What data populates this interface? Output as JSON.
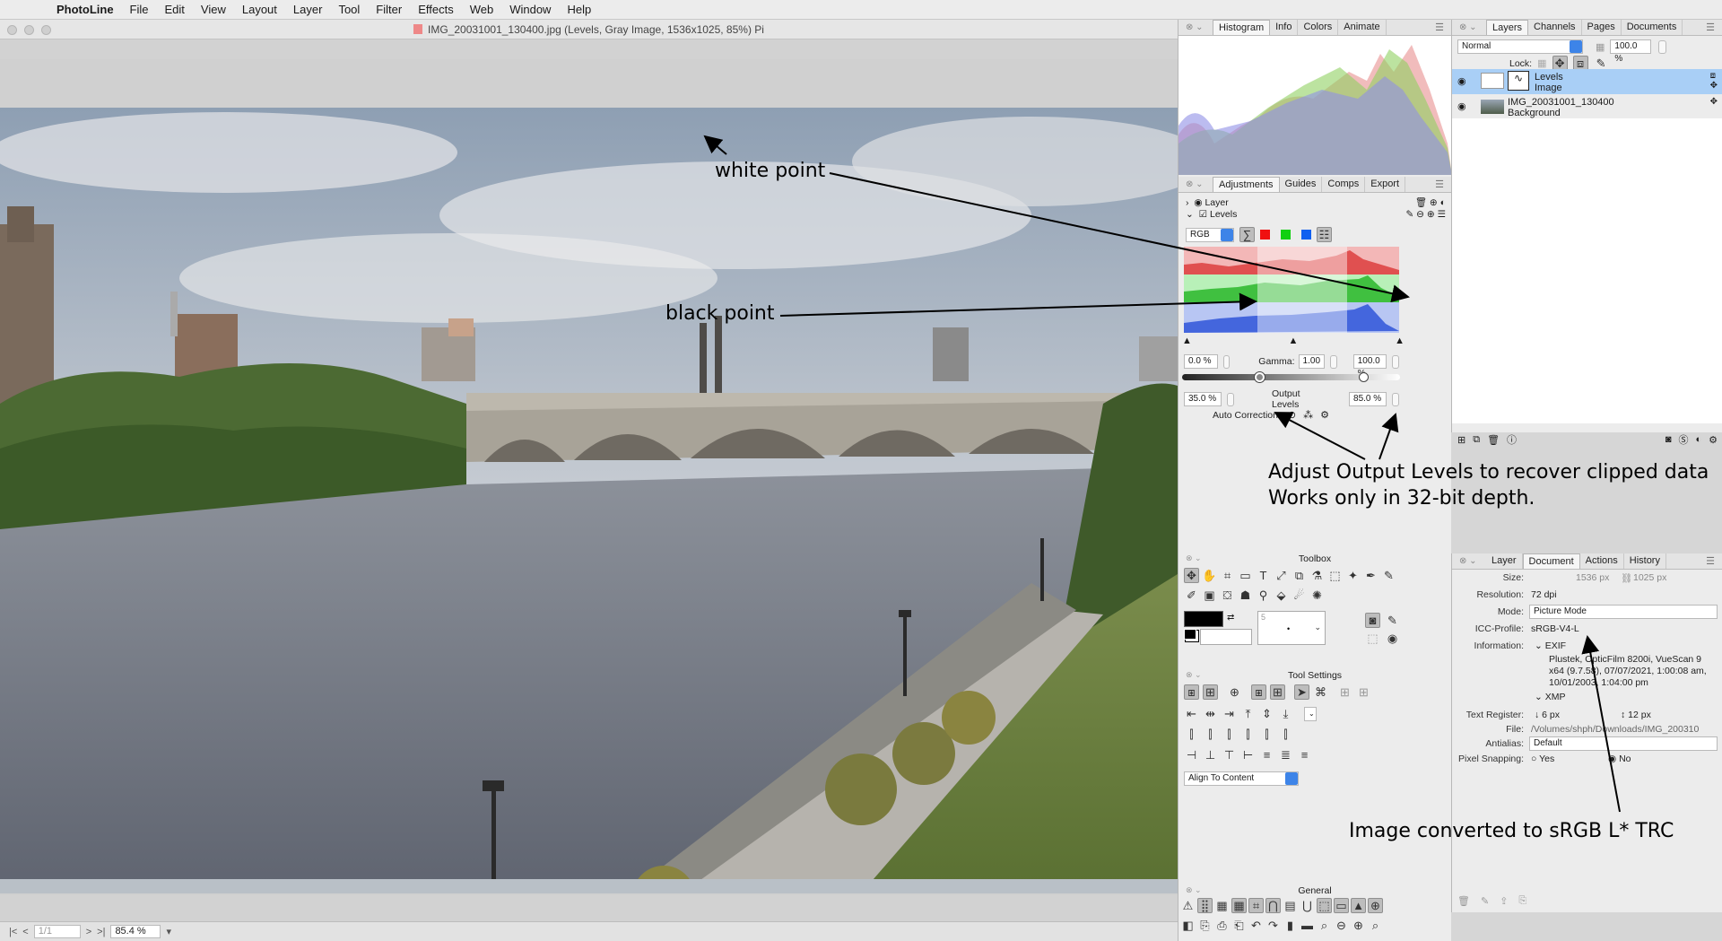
{
  "menubar": {
    "app": "PhotoLine",
    "items": [
      "File",
      "Edit",
      "View",
      "Layout",
      "Layer",
      "Tool",
      "Filter",
      "Effects",
      "Web",
      "Window",
      "Help"
    ]
  },
  "window": {
    "title": "IMG_20031001_130400.jpg (Levels, Gray Image, 1536x1025, 85%) Pi"
  },
  "statusbar": {
    "page": "1/1",
    "zoom": "85.4 %"
  },
  "histogram_panel": {
    "tabs": [
      "Histogram",
      "Info",
      "Colors",
      "Animate"
    ]
  },
  "adjust_panel": {
    "tabs": [
      "Adjustments",
      "Guides",
      "Comps",
      "Export"
    ],
    "layer_row": "Layer",
    "levels_row": "Levels",
    "channel": "RGB",
    "input_black": "0.0 %",
    "gamma_label": "Gamma:",
    "gamma": "1.00",
    "input_white": "100.0 %",
    "output_black": "35.0 %",
    "output_label": "Output Levels",
    "output_white": "85.0 %",
    "auto_label": "Auto Correction:"
  },
  "layers_panel": {
    "tabs": [
      "Layers",
      "Channels",
      "Pages",
      "Documents"
    ],
    "blend": "Normal",
    "opacity": "100.0 %",
    "lock_label": "Lock:",
    "layers": [
      {
        "name": "Levels",
        "sub": "Image",
        "selected": true
      },
      {
        "name": "IMG_20031001_130400",
        "sub": "Background",
        "selected": false
      }
    ]
  },
  "doc_panel": {
    "tabs": [
      "Layer",
      "Document",
      "Actions",
      "History"
    ],
    "size_label": "Size:",
    "size_w": "1536 px",
    "size_h": "1025 px",
    "resolution_label": "Resolution:",
    "resolution": "72 dpi",
    "mode_label": "Mode:",
    "mode": "Picture Mode",
    "icc_label": "ICC-Profile:",
    "icc": "sRGB-V4-L",
    "info_label": "Information:",
    "exif": "EXIF",
    "exif_text": [
      "Plustek, OpticFilm 8200i, VueScan 9",
      "x64 (9.7.58), 07/07/2021, 1:00:08 am,",
      "10/01/2003, 1:04:00 pm"
    ],
    "xmp": "XMP",
    "register_label": "Text Register:",
    "register_a": "6 px",
    "register_b": "12 px",
    "file_label": "File:",
    "file": "/Volumes/shph/Downloads/IMG_200310",
    "antialias_label": "Antialias:",
    "antialias": "Default",
    "snap_label": "Pixel Snapping:",
    "snap_yes": "Yes",
    "snap_no": "No"
  },
  "toolbox": {
    "title": "Toolbox",
    "brush_size": "5"
  },
  "tool_settings": {
    "title": "Tool Settings",
    "align": "Align To Content"
  },
  "general": {
    "title": "General"
  },
  "annotations": {
    "white_point": "white point",
    "black_point": "black point",
    "adjust_1": "Adjust Output Levels to recover clipped data",
    "adjust_2": "Works only in 32-bit depth.",
    "image_converted": "Image converted to sRGB L* TRC"
  },
  "colors": {
    "selection": "#a9cff6",
    "accent": "#3d84e8",
    "red": "#f01010",
    "green": "#10d010",
    "blue": "#1060f0"
  }
}
